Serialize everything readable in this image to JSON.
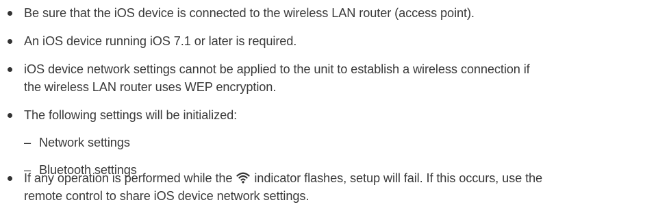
{
  "notes": {
    "item_1": "Be sure that the iOS device is connected to the wireless LAN router (access point).",
    "item_2": "An iOS device running iOS 7.1 or later is required.",
    "item_3_line_1": "iOS device network settings cannot be applied to the unit to establish a wireless connection if",
    "item_3_line_2": "the wireless LAN router uses WEP encryption.",
    "item_4": "The following settings will be initialized:",
    "sub_dash": "–",
    "sub_item_1": "Network settings",
    "sub_item_2": "Bluetooth settings",
    "item_5_line_1_before": "If any operation is performed while the",
    "item_5_icon": "wifi-icon",
    "item_5_line_1_after": "indicator flashes, setup will fail. If this occurs, use the",
    "item_5_line_2": "remote control to share iOS device network settings."
  }
}
